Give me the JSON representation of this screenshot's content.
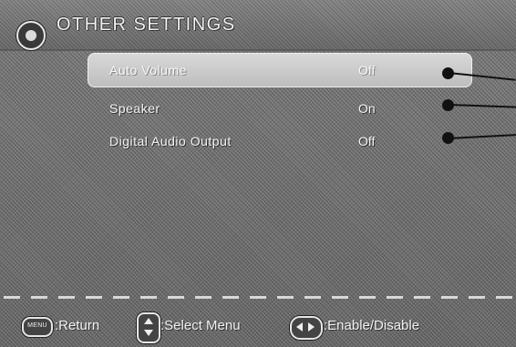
{
  "header": {
    "title": "OTHER SETTINGS",
    "logo_icon": "circle-logo-icon"
  },
  "menu": {
    "items": [
      {
        "label": "Auto Volume",
        "value": "Off",
        "selected": true
      },
      {
        "label": "Speaker",
        "value": "On",
        "selected": false
      },
      {
        "label": "Digital Audio Output",
        "value": "Off",
        "selected": false
      }
    ]
  },
  "footer": {
    "menu_key_label": "MENU",
    "return_label": ":Return",
    "select_label": ":Select Menu",
    "enable_label": ":Enable/Disable",
    "icons": [
      "menu-key-icon",
      "up-down-arrows-icon",
      "left-right-arrows-icon"
    ]
  },
  "colors": {
    "background": "#777777",
    "highlight": "#d0d0d0",
    "text": "#f2f2f2",
    "callout": "#111111"
  }
}
